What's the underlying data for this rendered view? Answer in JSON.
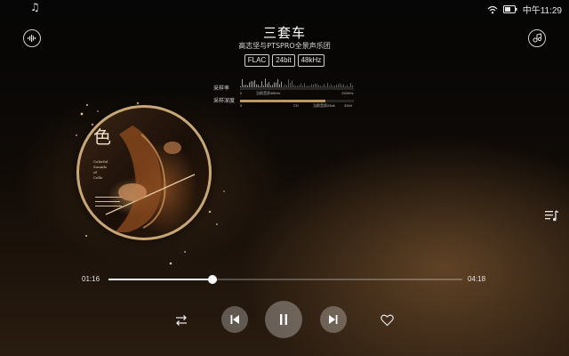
{
  "status_bar": {
    "left_icon": "music-note-icon",
    "time": "中午11:29"
  },
  "song": {
    "title": "三套车",
    "artist": "高志坚与PTSPRO全景声乐团",
    "badges": [
      "FLAC",
      "24bit",
      "48kHz"
    ]
  },
  "sample_info": {
    "sample_rate_label": "采样率",
    "sample_rate_current": "当前音质48kHz",
    "sample_rate_max": "192kHz",
    "sample_rate_min": "0",
    "bit_depth_label": "采样深度",
    "bit_depth_min": "0",
    "bit_depth_cd": "CD",
    "bit_depth_current": "当前音质24bit",
    "bit_depth_max": "32bit",
    "bit_depth_fraction": 0.75
  },
  "playback": {
    "current_time": "01:16",
    "total_time": "04:18",
    "progress_fraction": 0.295
  },
  "icons": {
    "sound_effect": "sound-effect-icon",
    "share": "share-icon",
    "playlist": "playlist-icon",
    "repeat": "repeat-icon",
    "previous": "previous-icon",
    "pause": "pause-icon",
    "next": "next-icon",
    "like": "heart-icon"
  },
  "colors": {
    "accent": "#c7a875",
    "progress": "#ffffff"
  }
}
